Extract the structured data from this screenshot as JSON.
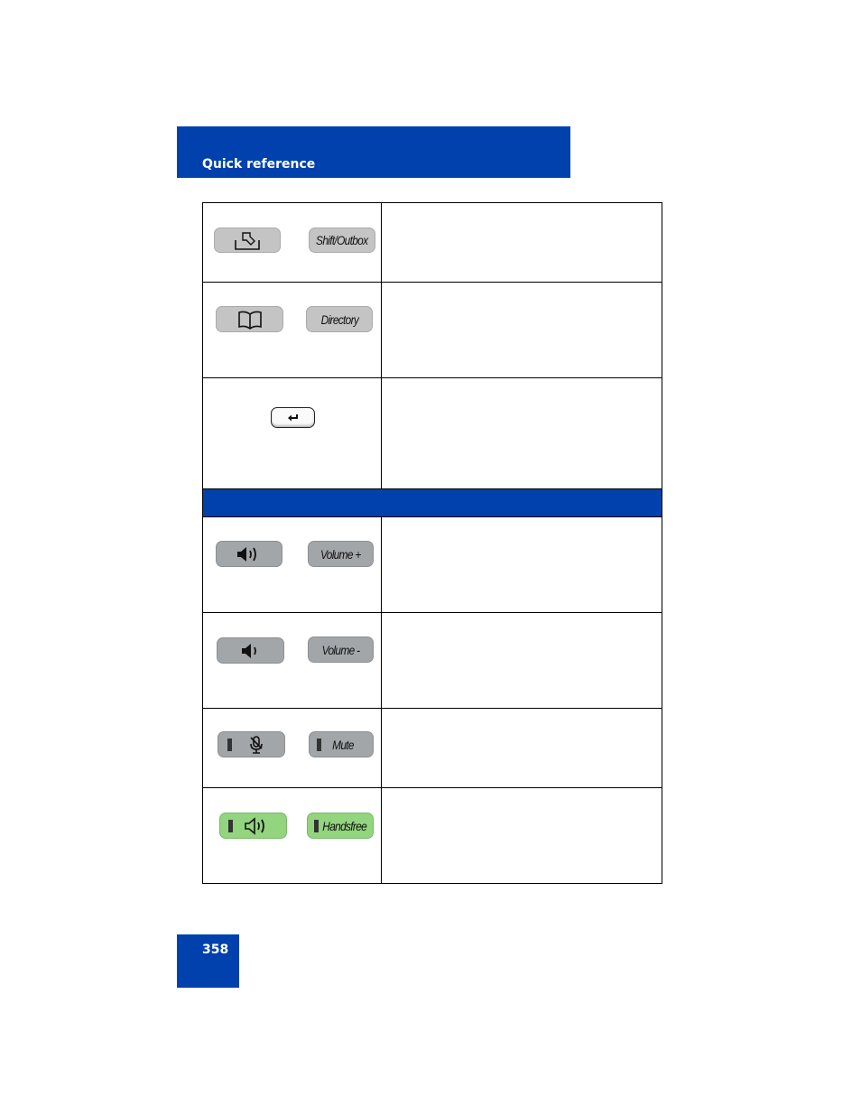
{
  "header": {
    "title": "Quick reference"
  },
  "footer": {
    "page_number": "358"
  },
  "colors": {
    "brand_blue": "#0041ad",
    "key_grey": "#c4c4c4",
    "key_dark": "#a3a6a9",
    "key_green": "#93d47e"
  },
  "rows": [
    {
      "icon_key": "outbox-icon",
      "text_key": "Shift/Outbox",
      "description": ""
    },
    {
      "icon_key": "directory-book-icon",
      "text_key": "Directory",
      "description": ""
    },
    {
      "icon_key": "enter-return-icon",
      "text_key": "",
      "description": ""
    },
    {
      "section": true,
      "title": ""
    },
    {
      "icon_key": "volume-up-icon",
      "text_key": "Volume +",
      "description": ""
    },
    {
      "icon_key": "volume-down-icon",
      "text_key": "Volume -",
      "description": ""
    },
    {
      "icon_key": "mute-microphone-icon",
      "text_key": "Mute",
      "description": ""
    },
    {
      "icon_key": "handsfree-speaker-icon",
      "text_key": "Handsfree",
      "description": ""
    }
  ]
}
